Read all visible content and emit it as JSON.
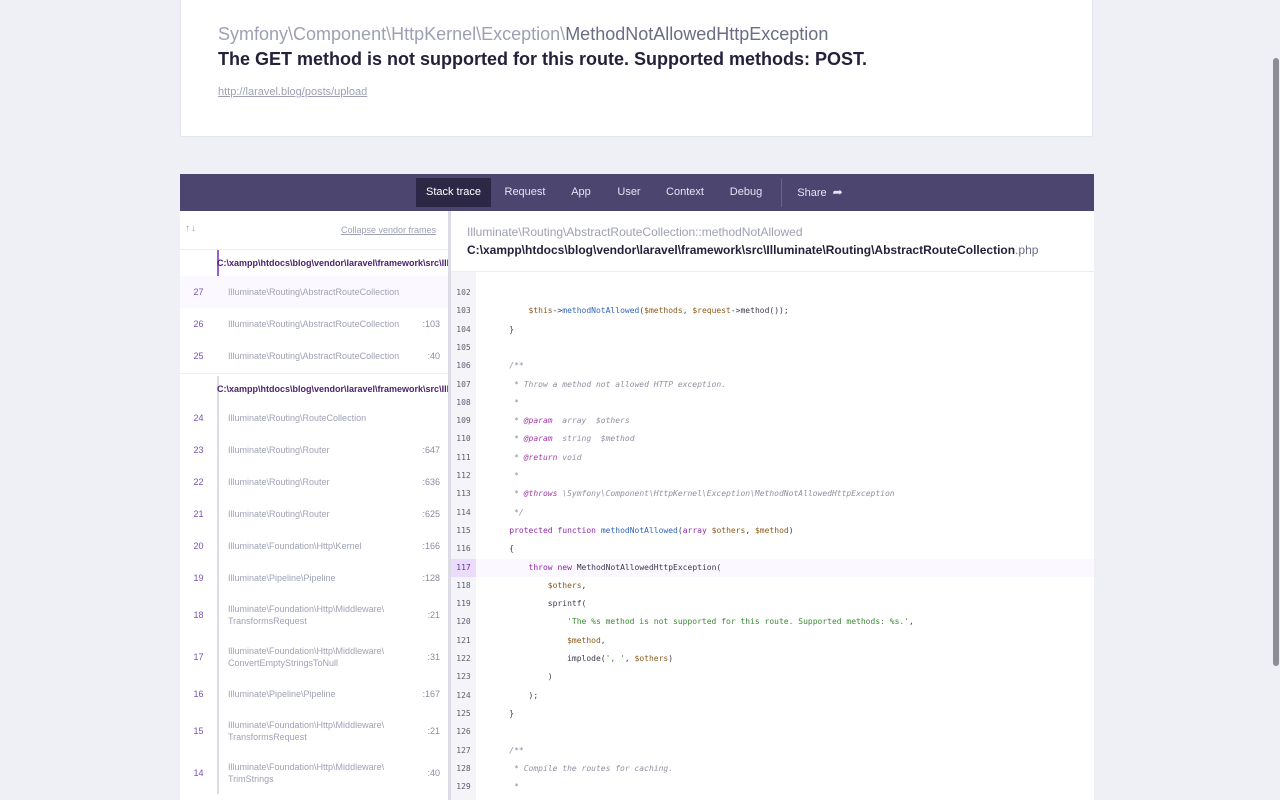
{
  "header": {
    "exception_namespace": "Symfony\\Component\\HttpKernel\\Exception\\",
    "exception_short": "MethodNotAllowedHttpException",
    "message": "The GET method is not supported for this route. Supported methods: POST.",
    "url": "http://laravel.blog/posts/upload"
  },
  "tabs": [
    {
      "label": "Stack trace",
      "active": true
    },
    {
      "label": "Request"
    },
    {
      "label": "App"
    },
    {
      "label": "User"
    },
    {
      "label": "Context"
    },
    {
      "label": "Debug"
    },
    {
      "label": "Share"
    }
  ],
  "sidebar": {
    "sort_icon": "sort-arrows-icon",
    "collapse_label": "Collapse vendor frames",
    "groups": [
      {
        "path": "C:\\xampp\\htdocs\\blog\\vendor\\laravel\\framework\\src\\Illuminate\\Routing\\AbstractRouteCollection.php",
        "frames": [
          {
            "num": "27",
            "label": "Illuminate\\Routing\\AbstractRouteCollection",
            "line": "",
            "selected": true
          },
          {
            "num": "26",
            "label": "Illuminate\\Routing\\AbstractRouteCollection",
            "line": ":103"
          },
          {
            "num": "25",
            "label": "Illuminate\\Routing\\AbstractRouteCollection",
            "line": ":40"
          }
        ]
      },
      {
        "path": "C:\\xampp\\htdocs\\blog\\vendor\\laravel\\framework\\src\\Illuminate\\Routing\\RouteCollection.php",
        "frames": [
          {
            "num": "24",
            "label": "Illuminate\\Routing\\RouteCollection",
            "line": ""
          },
          {
            "num": "23",
            "label": "Illuminate\\Routing\\Router",
            "line": ":647"
          },
          {
            "num": "22",
            "label": "Illuminate\\Routing\\Router",
            "line": ":636"
          },
          {
            "num": "21",
            "label": "Illuminate\\Routing\\Router",
            "line": ":625"
          },
          {
            "num": "20",
            "label": "Illuminate\\Foundation\\Http\\Kernel",
            "line": ":166"
          },
          {
            "num": "19",
            "label": "Illuminate\\Pipeline\\Pipeline",
            "line": ":128"
          },
          {
            "num": "18",
            "label": "Illuminate\\Foundation\\Http\\Middleware\\ TransformsRequest",
            "line": ":21"
          },
          {
            "num": "17",
            "label": "Illuminate\\Foundation\\Http\\Middleware\\ ConvertEmptyStringsToNull",
            "line": ":31"
          },
          {
            "num": "16",
            "label": "Illuminate\\Pipeline\\Pipeline",
            "line": ":167"
          },
          {
            "num": "15",
            "label": "Illuminate\\Foundation\\Http\\Middleware\\ TransformsRequest",
            "line": ":21"
          },
          {
            "num": "14",
            "label": "Illuminate\\Foundation\\Http\\Middleware\\ TrimStrings",
            "line": ":40"
          }
        ]
      }
    ]
  },
  "code": {
    "class_method": "Illuminate\\Routing\\AbstractRouteCollection::methodNotAllowed",
    "file_path": "C:\\xampp\\htdocs\\blog\\vendor\\laravel\\framework\\src\\Illuminate\\Routing\\AbstractRouteCollection",
    "file_ext": ".php",
    "highlight_line": 117,
    "lines": [
      {
        "n": "102",
        "code": ""
      },
      {
        "n": "103",
        "code": "        $this->methodNotAllowed($methods, $request->method());"
      },
      {
        "n": "104",
        "code": "    }"
      },
      {
        "n": "105",
        "code": ""
      },
      {
        "n": "106",
        "code": "    /**"
      },
      {
        "n": "107",
        "code": "     * Throw a method not allowed HTTP exception."
      },
      {
        "n": "108",
        "code": "     *"
      },
      {
        "n": "109",
        "code": "     * @param  array  $others"
      },
      {
        "n": "110",
        "code": "     * @param  string  $method"
      },
      {
        "n": "111",
        "code": "     * @return void"
      },
      {
        "n": "112",
        "code": "     *"
      },
      {
        "n": "113",
        "code": "     * @throws \\Symfony\\Component\\HttpKernel\\Exception\\MethodNotAllowedHttpException"
      },
      {
        "n": "114",
        "code": "     */"
      },
      {
        "n": "115",
        "code": "    protected function methodNotAllowed(array $others, $method)"
      },
      {
        "n": "116",
        "code": "    {"
      },
      {
        "n": "117",
        "code": "        throw new MethodNotAllowedHttpException("
      },
      {
        "n": "118",
        "code": "            $others,"
      },
      {
        "n": "119",
        "code": "            sprintf("
      },
      {
        "n": "120",
        "code": "                'The %s method is not supported for this route. Supported methods: %s.',"
      },
      {
        "n": "121",
        "code": "                $method,"
      },
      {
        "n": "122",
        "code": "                implode(', ', $others)"
      },
      {
        "n": "123",
        "code": "            )"
      },
      {
        "n": "124",
        "code": "        );"
      },
      {
        "n": "125",
        "code": "    }"
      },
      {
        "n": "126",
        "code": ""
      },
      {
        "n": "127",
        "code": "    /**"
      },
      {
        "n": "128",
        "code": "     * Compile the routes for caching."
      },
      {
        "n": "129",
        "code": "     *"
      }
    ]
  },
  "colors": {
    "tabbar": "#4c4570",
    "tab_active": "#2d2746",
    "accent": "#9a5cd6"
  }
}
